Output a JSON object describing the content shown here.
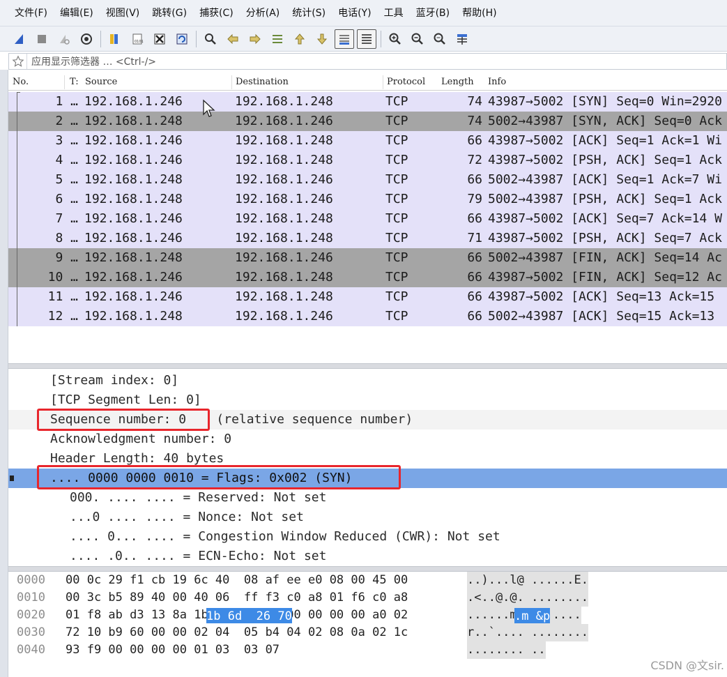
{
  "menu": [
    "文件(F)",
    "编辑(E)",
    "视图(V)",
    "跳转(G)",
    "捕获(C)",
    "分析(A)",
    "统计(S)",
    "电话(Y)",
    "工具",
    "蓝牙(B)",
    "帮助(H)"
  ],
  "toolbar": {
    "icons": [
      "shark-fin-start-icon",
      "stop-capture-icon",
      "restart-capture-icon",
      "capture-options-icon",
      "open-file-icon",
      "save-file-icon",
      "close-file-icon",
      "reload-file-icon",
      "find-packet-icon",
      "go-back-icon",
      "go-forward-icon",
      "go-to-packet-icon",
      "go-first-packet-icon",
      "go-last-packet-icon",
      "auto-scroll-icon",
      "colorize-icon",
      "zoom-in-icon",
      "zoom-out-icon",
      "normal-size-icon",
      "resize-columns-icon"
    ]
  },
  "filter": {
    "placeholder": "应用显示筛选器 … <Ctrl-/>"
  },
  "packet_list": {
    "columns": [
      "No.",
      "T:",
      "Source",
      "Destination",
      "Protocol",
      "Length",
      "Info"
    ],
    "rows": [
      {
        "no": "1 …",
        "source": "192.168.1.246",
        "destination": "192.168.1.248",
        "protocol": "TCP",
        "length": "74",
        "info": "43987→5002 [SYN] Seq=0 Win=2920",
        "style": "normal"
      },
      {
        "no": "2 …",
        "source": "192.168.1.248",
        "destination": "192.168.1.246",
        "protocol": "TCP",
        "length": "74",
        "info": "5002→43987 [SYN, ACK] Seq=0 Ack",
        "style": "dark"
      },
      {
        "no": "3 …",
        "source": "192.168.1.246",
        "destination": "192.168.1.248",
        "protocol": "TCP",
        "length": "66",
        "info": "43987→5002 [ACK] Seq=1 Ack=1 Wi",
        "style": "normal"
      },
      {
        "no": "4 …",
        "source": "192.168.1.246",
        "destination": "192.168.1.248",
        "protocol": "TCP",
        "length": "72",
        "info": "43987→5002 [PSH, ACK] Seq=1 Ack",
        "style": "normal"
      },
      {
        "no": "5 …",
        "source": "192.168.1.248",
        "destination": "192.168.1.246",
        "protocol": "TCP",
        "length": "66",
        "info": "5002→43987 [ACK] Seq=1 Ack=7 Wi",
        "style": "normal"
      },
      {
        "no": "6 …",
        "source": "192.168.1.248",
        "destination": "192.168.1.246",
        "protocol": "TCP",
        "length": "79",
        "info": "5002→43987 [PSH, ACK] Seq=1 Ack",
        "style": "normal"
      },
      {
        "no": "7 …",
        "source": "192.168.1.246",
        "destination": "192.168.1.248",
        "protocol": "TCP",
        "length": "66",
        "info": "43987→5002 [ACK] Seq=7 Ack=14 W",
        "style": "normal"
      },
      {
        "no": "8 …",
        "source": "192.168.1.246",
        "destination": "192.168.1.248",
        "protocol": "TCP",
        "length": "71",
        "info": "43987→5002 [PSH, ACK] Seq=7 Ack",
        "style": "normal"
      },
      {
        "no": "9 …",
        "source": "192.168.1.248",
        "destination": "192.168.1.246",
        "protocol": "TCP",
        "length": "66",
        "info": "5002→43987 [FIN, ACK] Seq=14 Ac",
        "style": "dark"
      },
      {
        "no": "10 …",
        "source": "192.168.1.246",
        "destination": "192.168.1.248",
        "protocol": "TCP",
        "length": "66",
        "info": "43987→5002 [FIN, ACK] Seq=12 Ac",
        "style": "dark"
      },
      {
        "no": "11 …",
        "source": "192.168.1.246",
        "destination": "192.168.1.248",
        "protocol": "TCP",
        "length": "66",
        "info": "43987→5002 [ACK] Seq=13 Ack=15",
        "style": "normal"
      },
      {
        "no": "12 …",
        "source": "192.168.1.248",
        "destination": "192.168.1.246",
        "protocol": "TCP",
        "length": "66",
        "info": "5002→43987 [ACK] Seq=15 Ack=13",
        "style": "normal"
      }
    ]
  },
  "details": {
    "lines": [
      {
        "text": "[Stream index: 0]",
        "indent": 1,
        "style": "plain"
      },
      {
        "text": "[TCP Segment Len: 0]",
        "indent": 1,
        "style": "plain"
      },
      {
        "text": "Sequence number: 0    (relative sequence number)",
        "indent": 1,
        "style": "alt"
      },
      {
        "text": "Acknowledgment number: 0",
        "indent": 1,
        "style": "plain"
      },
      {
        "text": "Header Length: 40 bytes",
        "indent": 1,
        "style": "plain"
      },
      {
        "text": ".... 0000 0000 0010 = Flags: 0x002 (SYN)",
        "indent": 0,
        "style": "selected"
      },
      {
        "text": "000. .... .... = Reserved: Not set",
        "indent": 2,
        "style": "plain"
      },
      {
        "text": "...0 .... .... = Nonce: Not set",
        "indent": 2,
        "style": "plain"
      },
      {
        "text": ".... 0... .... = Congestion Window Reduced (CWR): Not set",
        "indent": 2,
        "style": "plain"
      },
      {
        "text": ".... .0.. .... = ECN-Echo: Not set",
        "indent": 2,
        "style": "plain"
      }
    ]
  },
  "bytes": {
    "lines": [
      {
        "offset": "0000",
        "hex": "00 0c 29 f1 cb 19 6c 40  08 af ee e0 08 00 45 00",
        "ascii": "..)...l@ ......E."
      },
      {
        "offset": "0010",
        "hex": "00 3c b5 89 40 00 40 06  ff f3 c0 a8 01 f6 c0 a8",
        "ascii": ".<..@.@. ........"
      },
      {
        "offset": "0020",
        "hex": "01 f8 ab d3 13 8a 1b 6d  26 70 00 00 00 00 a0 02",
        "ascii": "......m &p......"
      },
      {
        "offset": "0030",
        "hex": "72 10 b9 60 00 00 02 04  05 b4 04 02 08 0a 02 1c",
        "ascii": "r..`.... ........"
      },
      {
        "offset": "0040",
        "hex": "93 f9 00 00 00 00 01 03  03 07",
        "ascii": "........ .."
      }
    ],
    "highlight": {
      "line": 2,
      "hex": "1b 6d  26 70",
      "ascii": ".m &p"
    }
  },
  "watermark": "CSDN @文sir."
}
